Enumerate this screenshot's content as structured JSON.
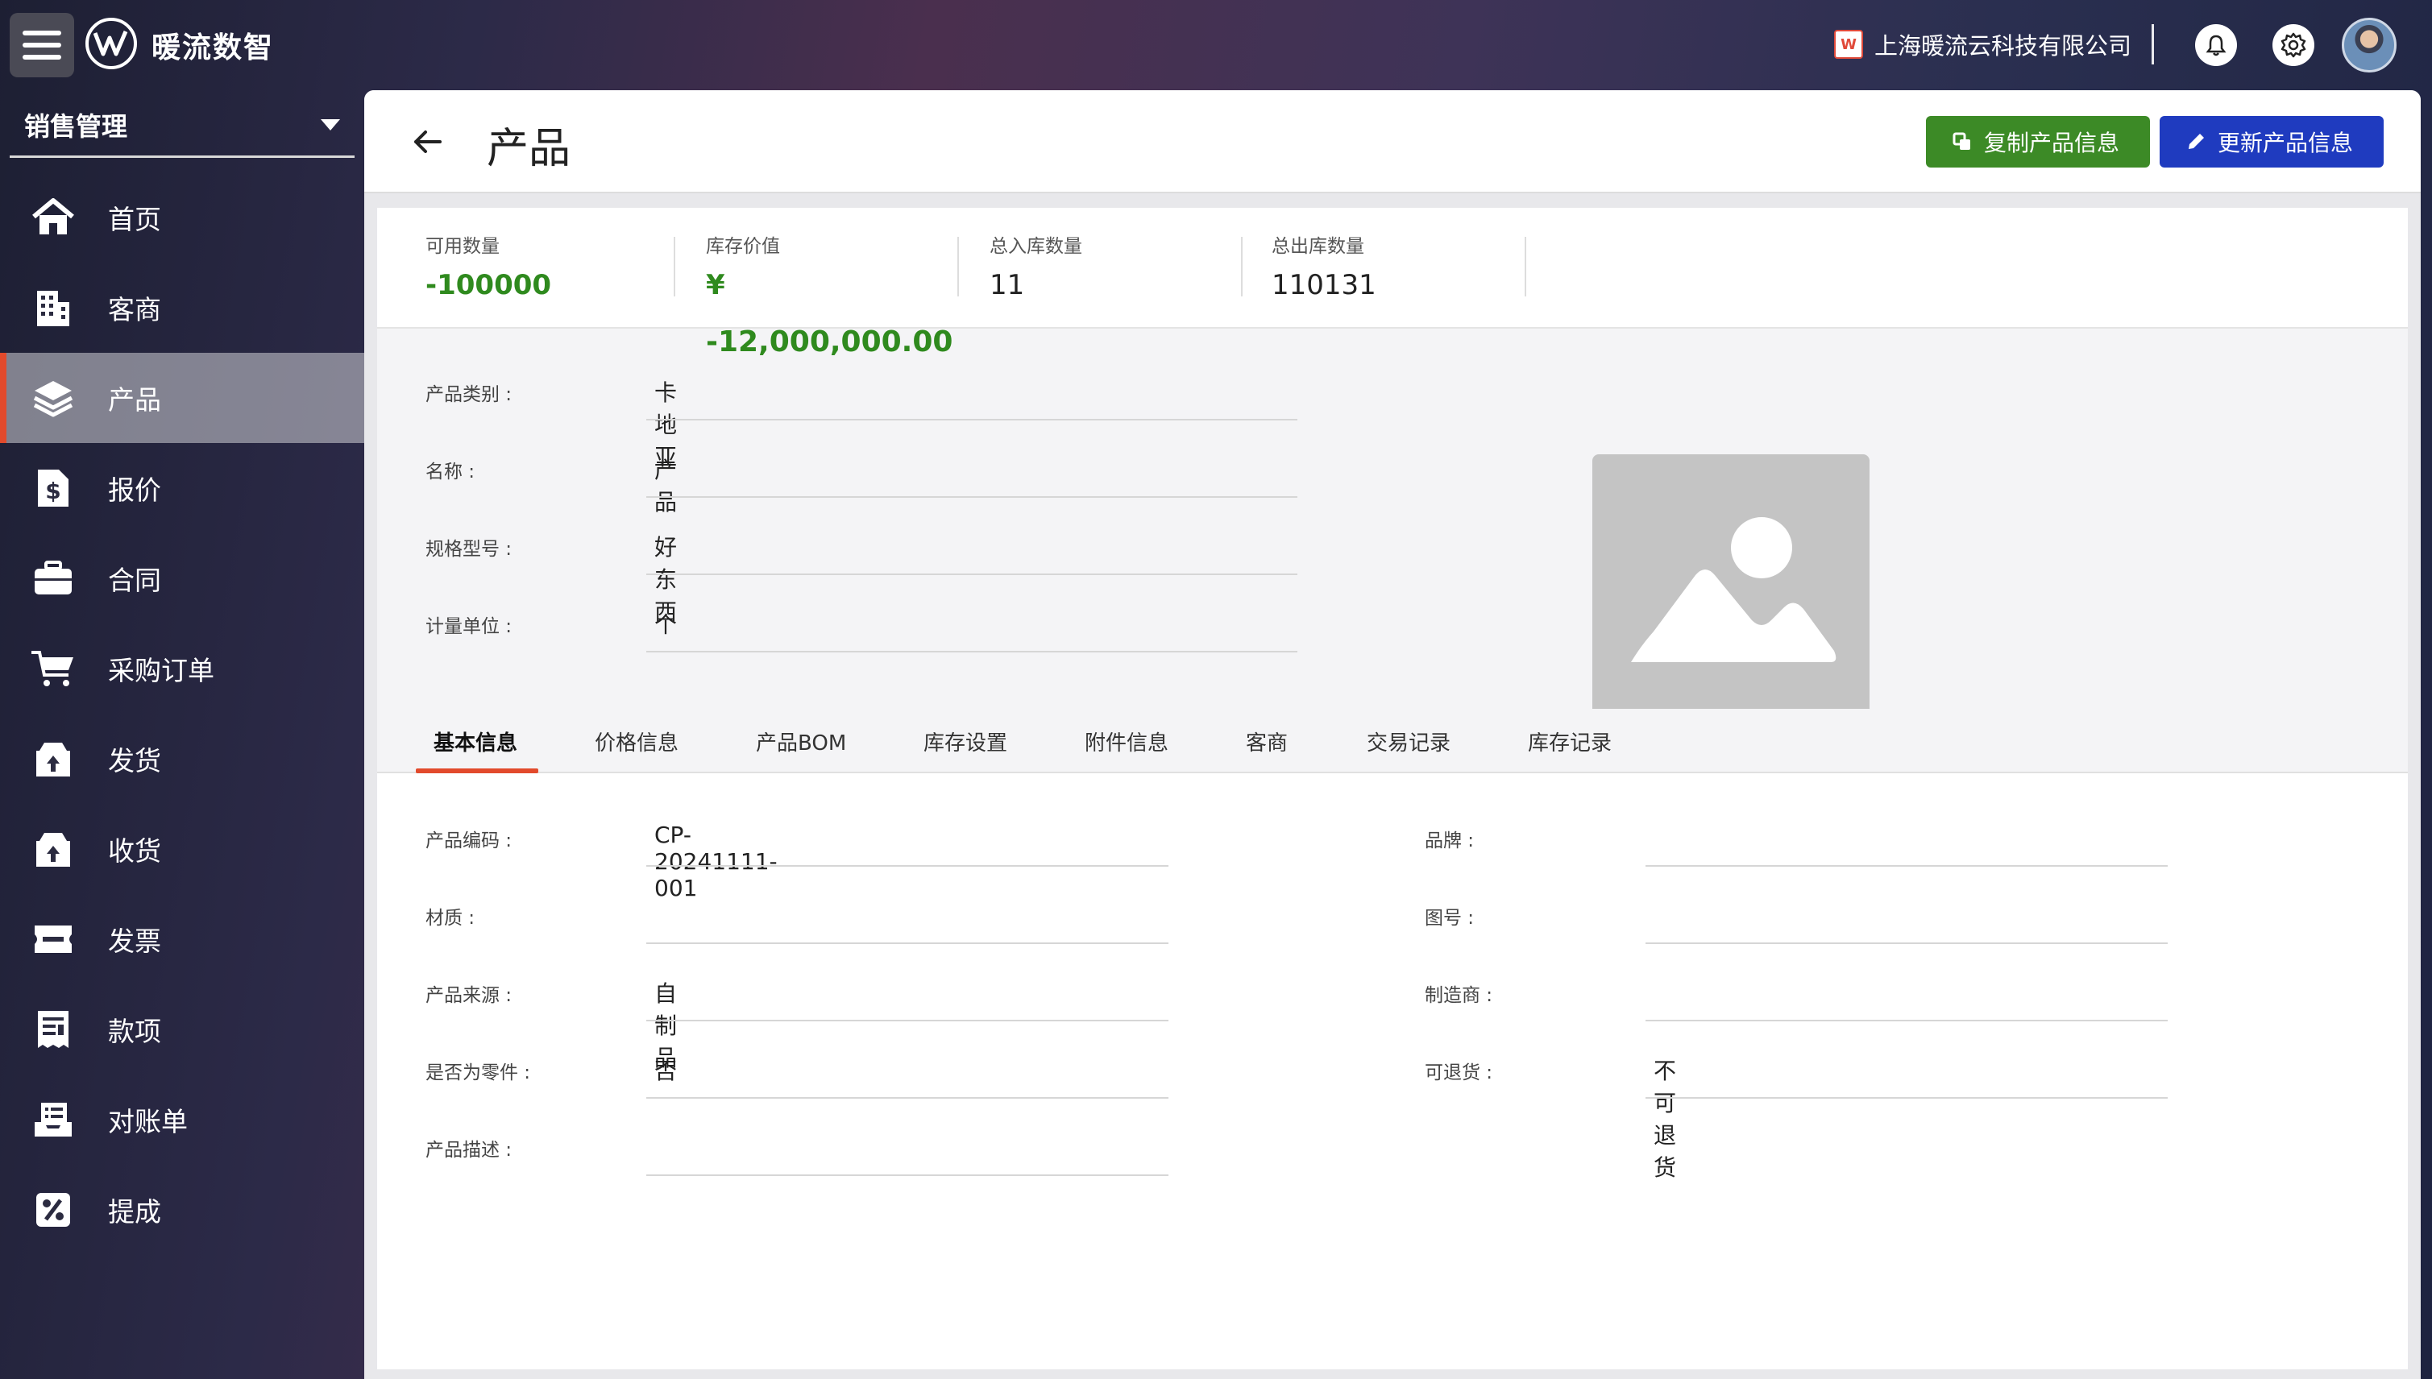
{
  "topbar": {
    "app_name": "暖流数智",
    "company": "上海暖流云科技有限公司"
  },
  "sidebar": {
    "module": "销售管理",
    "items": [
      {
        "label": "首页",
        "icon": "home-icon"
      },
      {
        "label": "客商",
        "icon": "building-icon"
      },
      {
        "label": "产品",
        "icon": "layers-icon",
        "active": true
      },
      {
        "label": "报价",
        "icon": "dollar-doc-icon"
      },
      {
        "label": "合同",
        "icon": "briefcase-icon"
      },
      {
        "label": "采购订单",
        "icon": "cart-icon"
      },
      {
        "label": "发货",
        "icon": "box-up-icon"
      },
      {
        "label": "收货",
        "icon": "box-in-icon"
      },
      {
        "label": "发票",
        "icon": "ticket-icon"
      },
      {
        "label": "款项",
        "icon": "receipt-icon"
      },
      {
        "label": "对账单",
        "icon": "inbox-list-icon"
      },
      {
        "label": "提成",
        "icon": "percent-icon"
      }
    ]
  },
  "header": {
    "title": "产品",
    "copy_button": "复制产品信息",
    "update_button": "更新产品信息"
  },
  "stats": [
    {
      "label": "可用数量",
      "value": "-100000",
      "green": true
    },
    {
      "label": "库存价值",
      "value": "¥",
      "green": true,
      "value2": "-12,000,000.00"
    },
    {
      "label": "总入库数量",
      "value": "11"
    },
    {
      "label": "总出库数量",
      "value": "110131"
    }
  ],
  "summary": {
    "category_label": "产品类别 :",
    "category": "卡地亚",
    "name_label": "名称 :",
    "name": "产品",
    "spec_label": "规格型号 :",
    "spec": "好东西",
    "unit_label": "计量单位 :",
    "unit": "个"
  },
  "tabs": [
    "基本信息",
    "价格信息",
    "产品BOM",
    "库存设置",
    "附件信息",
    "客商",
    "交易记录",
    "库存记录"
  ],
  "details": {
    "left": [
      {
        "label": "产品编码 :",
        "value": "CP-20241111-001"
      },
      {
        "label": "材质 :",
        "value": ""
      },
      {
        "label": "产品来源 :",
        "value": "自制品"
      },
      {
        "label": "是否为零件 :",
        "value": "否"
      },
      {
        "label": "产品描述 :",
        "value": ""
      }
    ],
    "right": [
      {
        "label": "品牌 :",
        "value": ""
      },
      {
        "label": "图号 :",
        "value": ""
      },
      {
        "label": "制造商 :",
        "value": ""
      },
      {
        "label": "可退货 :",
        "value": "不可退货"
      }
    ]
  },
  "colors": {
    "accent": "#e24a2c",
    "green": "#3c8a26",
    "blue": "#1f3bbf"
  }
}
